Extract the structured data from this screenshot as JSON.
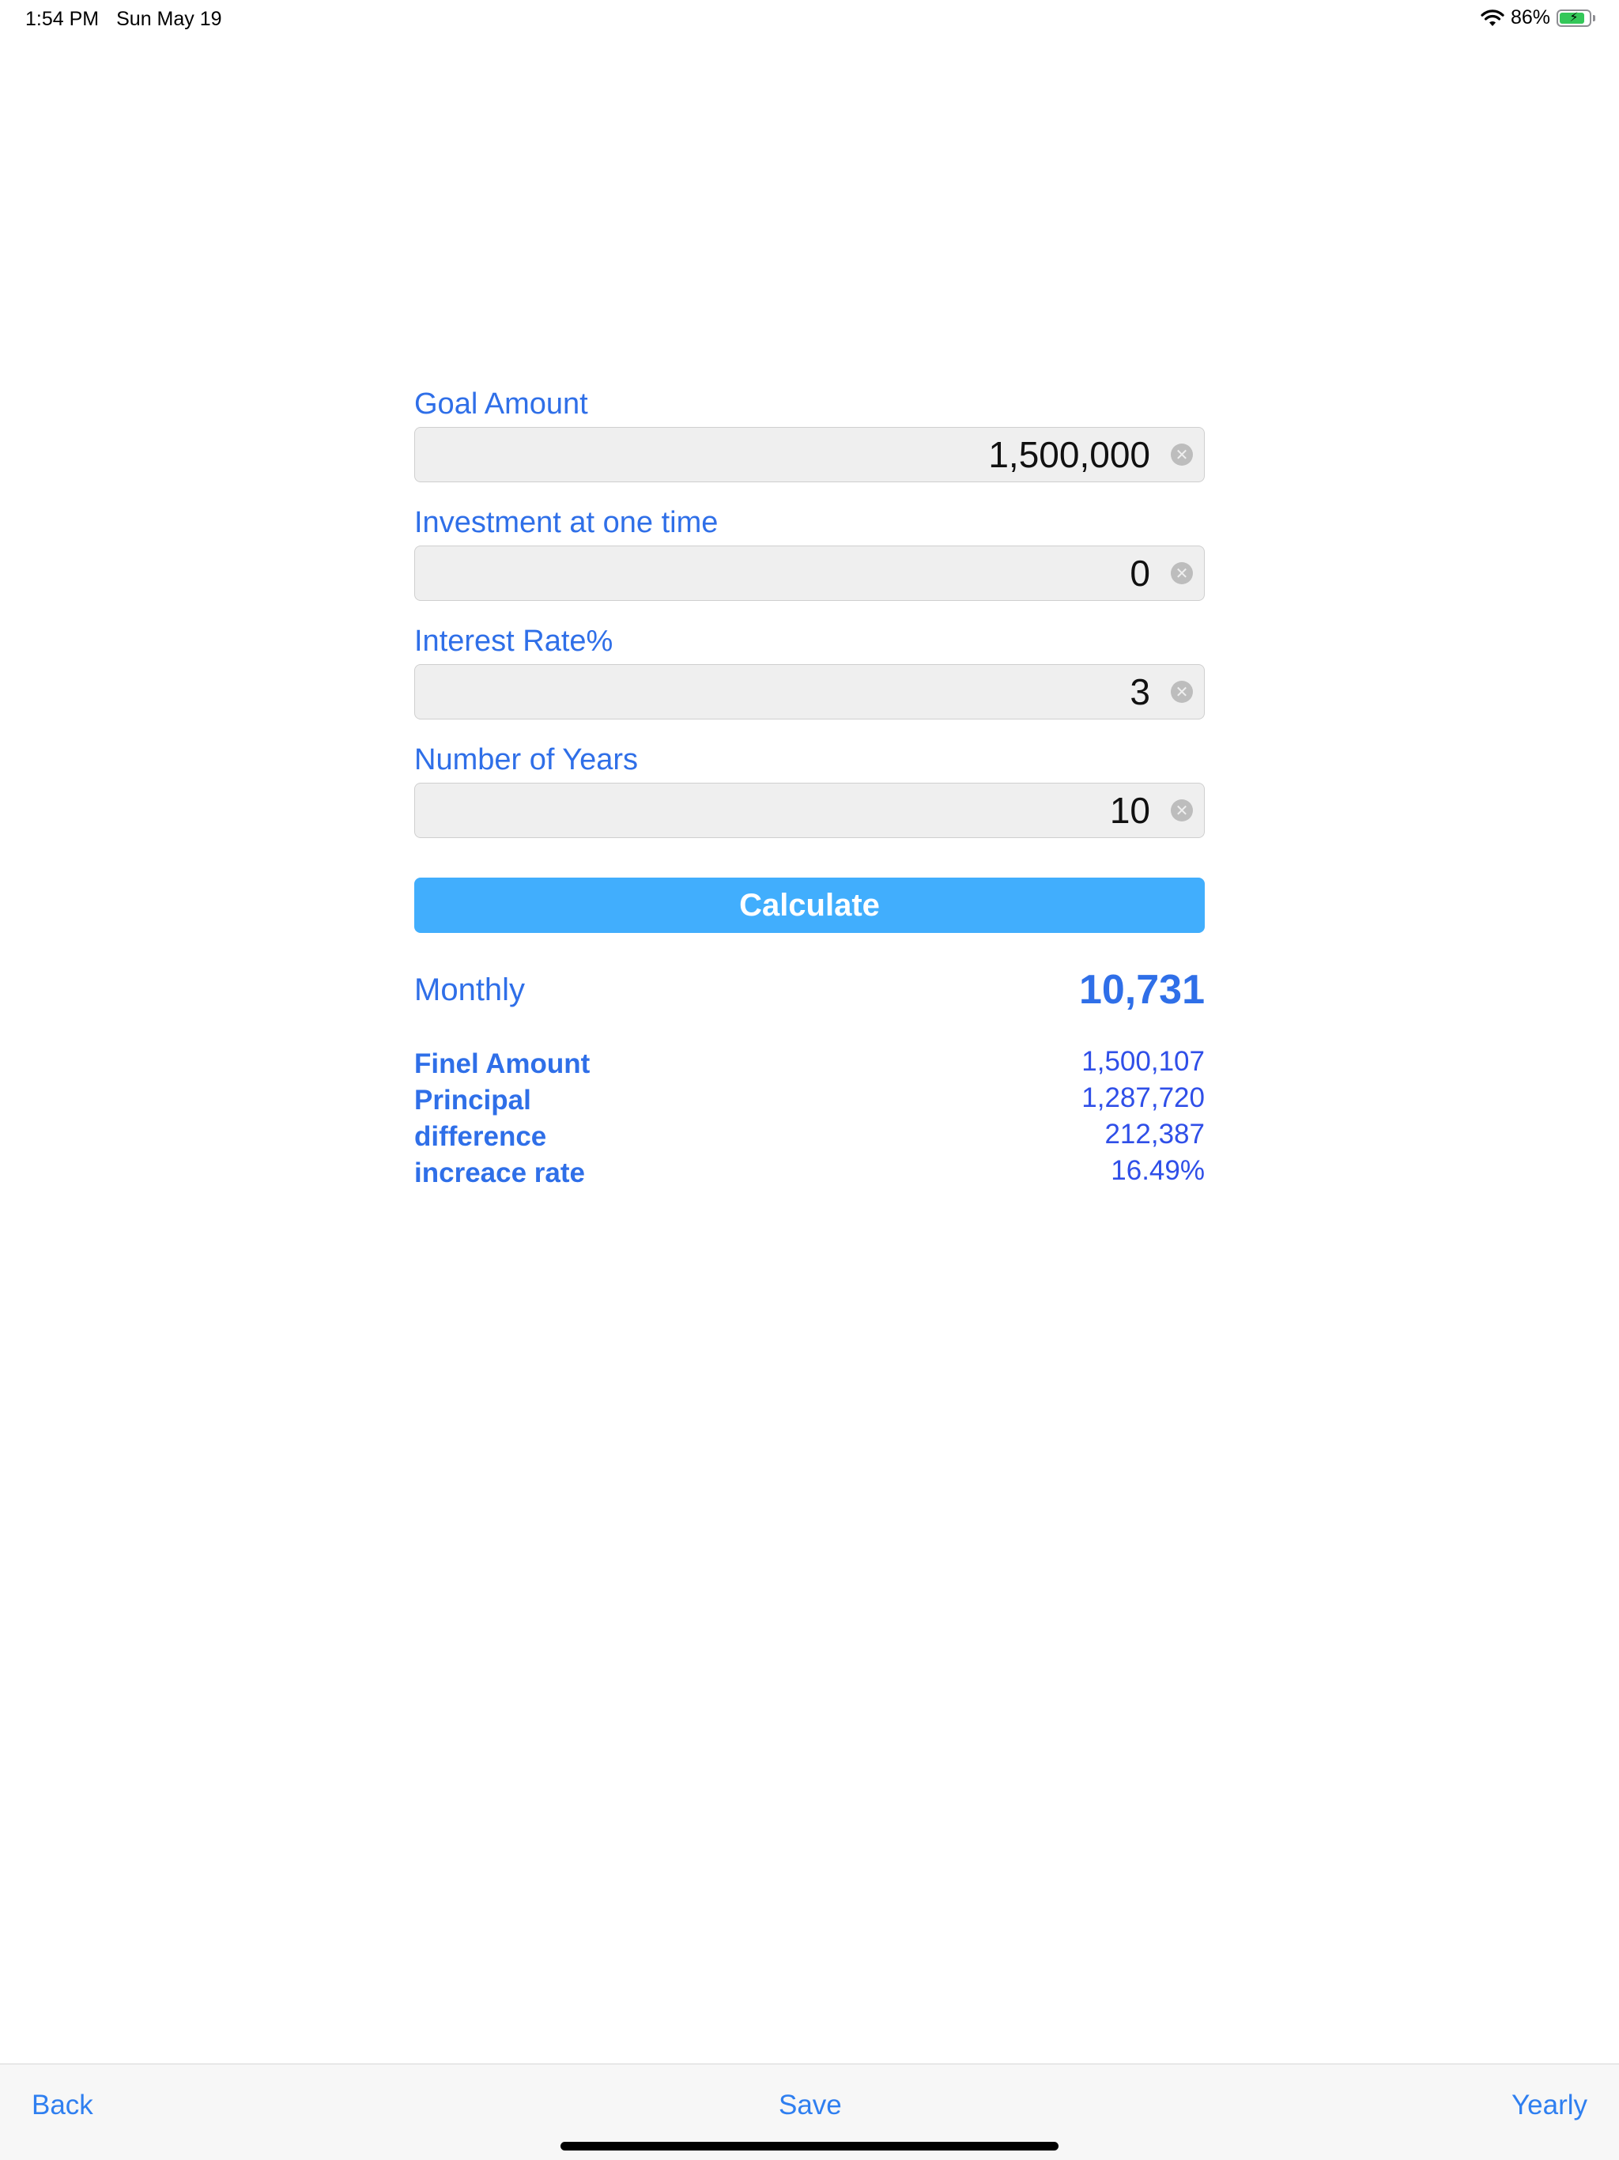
{
  "status_bar": {
    "time": "1:54 PM",
    "date": "Sun May 19",
    "battery_percent": "86%",
    "battery_level": 0.86,
    "wifi_icon": "wifi-icon",
    "battery_icon": "battery-charging-icon"
  },
  "form": {
    "fields": [
      {
        "label": "Goal Amount",
        "value": "1,500,000"
      },
      {
        "label": "Investment at one time",
        "value": "0"
      },
      {
        "label": "Interest Rate%",
        "value": "3"
      },
      {
        "label": "Number of Years",
        "value": "10"
      }
    ],
    "calculate_label": "Calculate"
  },
  "results": {
    "monthly_label": "Monthly",
    "monthly_value": "10,731",
    "rows": [
      {
        "label": "Finel Amount",
        "value": "1,500,107"
      },
      {
        "label": "Principal",
        "value": "1,287,720"
      },
      {
        "label": "difference",
        "value": "212,387"
      },
      {
        "label": "increace rate",
        "value": "16.49%"
      }
    ]
  },
  "toolbar": {
    "back_label": "Back",
    "save_label": "Save",
    "yearly_label": "Yearly"
  },
  "colors": {
    "accent": "#2f6fe8",
    "button": "#41aefd",
    "input_bg": "#efefef"
  }
}
